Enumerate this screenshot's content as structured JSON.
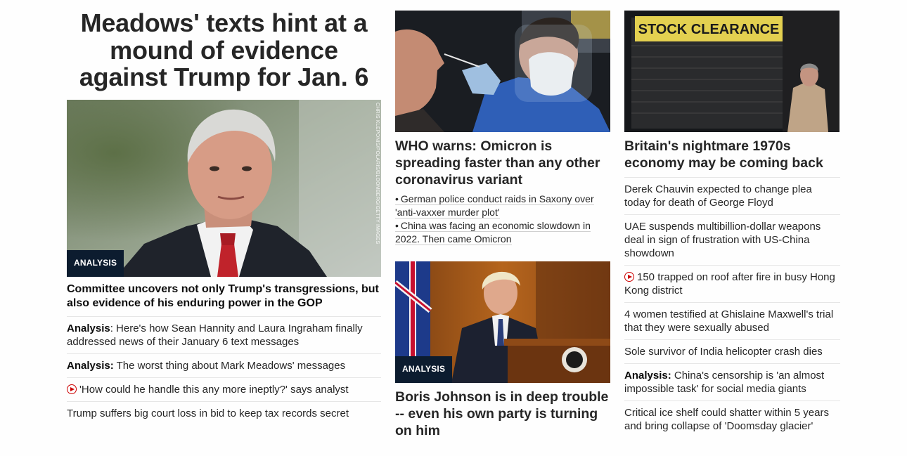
{
  "col1": {
    "headline": "Meadows' texts hint at a mound of evidence against Trump for Jan. 6",
    "photo_credit": "CHRIS KLEPONIS/POLARIS/BLOOMBERG/GETTY IMAGES",
    "badge": "ANALYSIS",
    "summary": "Committee uncovers not only Trump's transgressions, but also evidence of his enduring power in the GOP",
    "links": [
      {
        "prefix": "Analysis",
        "sep": ": ",
        "text": "Here's how Sean Hannity and Laura Ingraham finally addressed news of their January 6 text messages"
      },
      {
        "prefix": "Analysis:",
        "sep": " ",
        "text": "The worst thing about Mark Meadows' messages"
      },
      {
        "text": "'How could he handle this any more ineptly?' says analyst",
        "video": true
      },
      {
        "text": "Trump suffers big court loss in bid to keep tax records secret"
      }
    ]
  },
  "col2": {
    "story1": {
      "title": "WHO warns: Omicron is spreading faster than any other coronavirus variant",
      "bullet": "•",
      "sublinks": [
        "German police conduct raids in Saxony over 'anti-vaxxer murder plot'",
        "China was facing an economic slowdown in 2022. Then came Omicron"
      ]
    },
    "story2": {
      "badge": "ANALYSIS",
      "title": "Boris Johnson is in deep trouble -- even his own party is turning on him"
    }
  },
  "col3": {
    "sign_text": "STOCK CLEARANCE",
    "title": "Britain's nightmare 1970s economy may be coming back",
    "links": [
      {
        "text": "Derek Chauvin expected to change plea today for death of George Floyd"
      },
      {
        "text": "UAE suspends multibillion-dollar weapons deal in sign of frustration with US-China showdown"
      },
      {
        "text": "150 trapped on roof after fire in busy Hong Kong district",
        "video": true
      },
      {
        "text": "4 women testified at Ghislaine Maxwell's trial that they were sexually abused"
      },
      {
        "text": "Sole survivor of India helicopter crash dies"
      },
      {
        "prefix": "Analysis:",
        "sep": " ",
        "text": "China's censorship is 'an almost impossible task' for social media giants"
      },
      {
        "text": "Critical ice shelf could shatter within 5 years and bring collapse of 'Doomsday glacier'"
      }
    ]
  },
  "colors": {
    "badge_bg": "#0c1c2f",
    "video_red": "#cc0000",
    "divider": "#e6e6e6"
  }
}
